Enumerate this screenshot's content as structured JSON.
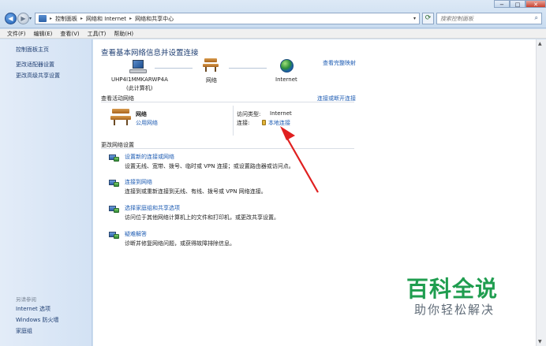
{
  "address": {
    "crumbs": [
      "控制面板",
      "网络和 Internet",
      "网络和共享中心"
    ],
    "search_placeholder": "搜索控制面板"
  },
  "menu": [
    "文件(F)",
    "编辑(E)",
    "查看(V)",
    "工具(T)",
    "帮助(H)"
  ],
  "sidebar": {
    "top_links": [
      "控制面板主页",
      "更改适配器设置",
      "更改高级共享设置"
    ],
    "see_also_title": "另请参阅",
    "bottom_links": [
      "Internet 选项",
      "Windows 防火墙",
      "家庭组"
    ]
  },
  "main": {
    "title": "查看基本网络信息并设置连接",
    "view_full_map": "查看完整映射",
    "map": {
      "computer": "UHP4I1MMKARWP4A",
      "computer_sub": "(此计算机)",
      "network": "网络",
      "internet": "Internet"
    },
    "active_section": "查看活动网络",
    "connect_disconnect": "连接或断开连接",
    "active": {
      "name": "网络",
      "type": "公用网络",
      "access_label": "访问类型:",
      "access_value": "Internet",
      "conn_label": "连接:",
      "conn_value": "本地连接"
    },
    "change_section": "更改网络设置",
    "tasks": [
      {
        "title": "设置新的连接或网络",
        "desc": "设置无线、宽带、拨号、临时或 VPN 连接；或设置路由器或访问点。"
      },
      {
        "title": "连接到网络",
        "desc": "连接到或重新连接到无线、有线、拨号或 VPN 网络连接。"
      },
      {
        "title": "选择家庭组和共享选项",
        "desc": "访问位于其他网络计算机上的文件和打印机，或更改共享设置。"
      },
      {
        "title": "疑难解答",
        "desc": "诊断并修复网络问题，或获得故障排除信息。"
      }
    ]
  },
  "window_buttons": [
    "−",
    "□",
    "✕"
  ],
  "watermark": {
    "big": "百科全说",
    "small": "助你轻松解决"
  },
  "colors": {
    "link": "#1e5cb3",
    "arrow": "#e02020",
    "watermark": "#1f9d4f"
  }
}
